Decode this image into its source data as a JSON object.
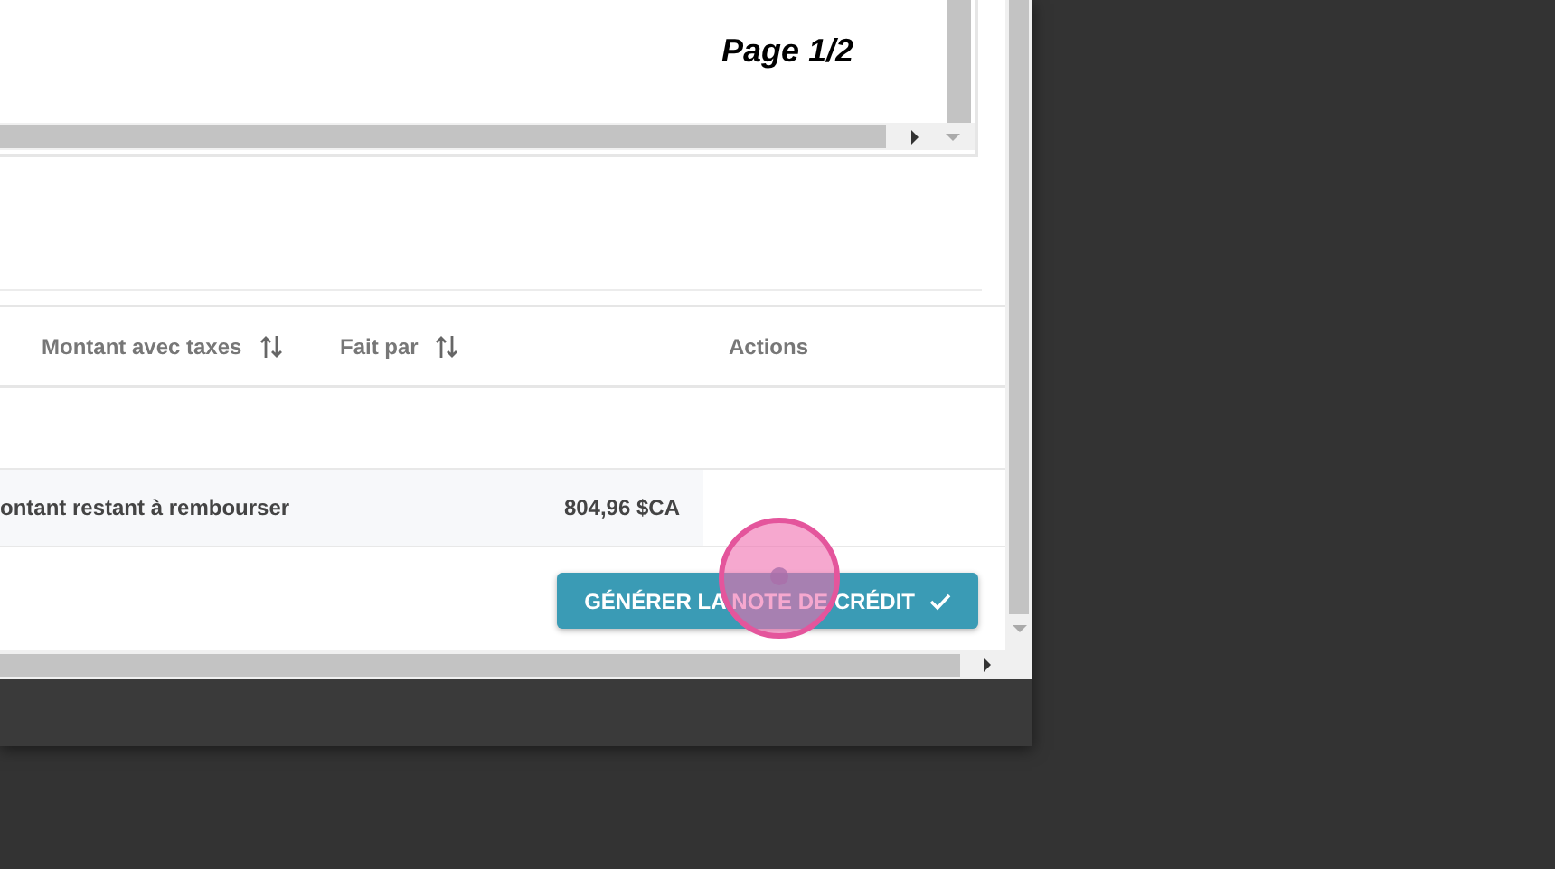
{
  "document_preview": {
    "page_label": "Page 1/2"
  },
  "table": {
    "columns": [
      {
        "label": "Montant avec taxes",
        "sortable": true
      },
      {
        "label": "Fait par",
        "sortable": true
      },
      {
        "label": "Actions",
        "sortable": false
      }
    ],
    "summary_row": {
      "label": "ontant restant à rembourser",
      "amount": "804,96 $CA"
    }
  },
  "actions": [
    {
      "label": "GÉNÉRER LA NOTE DE CRÉDIT"
    }
  ]
}
